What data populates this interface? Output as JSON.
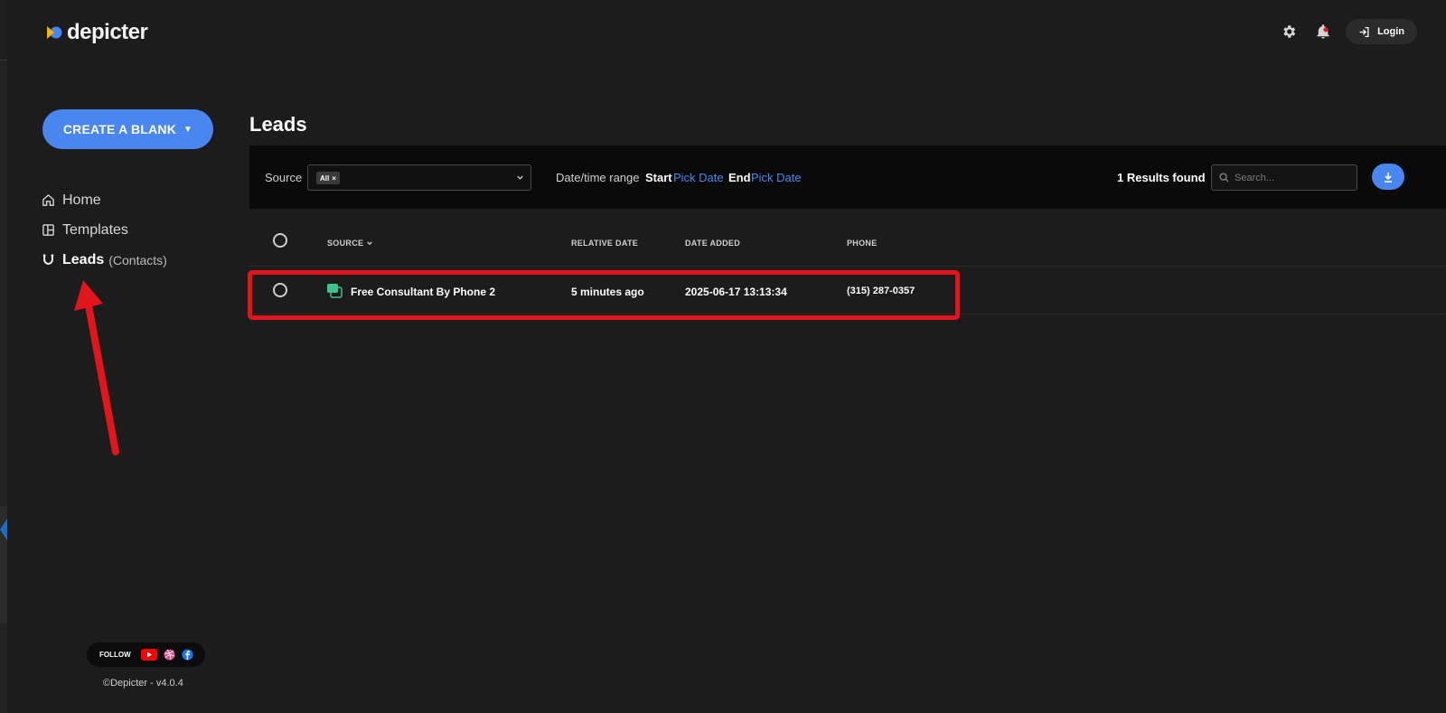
{
  "app": {
    "logo_text": "depicter"
  },
  "header": {
    "login_label": "Login"
  },
  "sidebar": {
    "create_label": "CREATE A BLANK",
    "items": [
      {
        "label": "Home",
        "icon": "home-icon"
      },
      {
        "label": "Templates",
        "icon": "templates-icon"
      },
      {
        "label": "Leads",
        "sub": "(Contacts)",
        "icon": "magnet-icon",
        "active": true
      }
    ],
    "follow_label": "FOLLOW",
    "version": "©Depicter - v4.0.4"
  },
  "page": {
    "title": "Leads"
  },
  "filters": {
    "source_label": "Source",
    "source_chip": "All",
    "date_range_label": "Date/time range",
    "start_label": "Start",
    "start_value": "Pick Date",
    "end_label": "End",
    "end_value": "Pick Date",
    "results_text": "1 Results found",
    "search_placeholder": "Search..."
  },
  "table": {
    "columns": [
      "SOURCE",
      "RELATIVE DATE",
      "DATE ADDED",
      "PHONE"
    ],
    "rows": [
      {
        "source": "Free Consultant By Phone 2",
        "relative_date": "5 minutes ago",
        "date_added": "2025-06-17 13:13:34",
        "phone": "(315) 287-0357"
      }
    ]
  },
  "colors": {
    "accent": "#4a86ef",
    "annotation": "#e3141b",
    "source_icon": "#3ec28f"
  }
}
